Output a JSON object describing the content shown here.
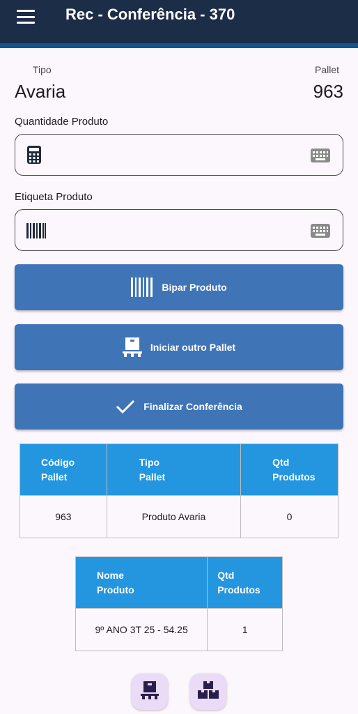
{
  "appbar": {
    "title": "Rec - Conferência - 370",
    "menu_icon": "menu-icon"
  },
  "header": {
    "tipo_label": "Tipo",
    "tipo_value": "Avaria",
    "pallet_label": "Pallet",
    "pallet_value": "963"
  },
  "form": {
    "quantidade": {
      "label": "Quantidade Produto",
      "value": "",
      "icon": "calculator-icon"
    },
    "etiqueta": {
      "label": "Etiqueta Produto",
      "value": "",
      "icon": "barcode-icon"
    }
  },
  "buttons": {
    "bipar": "Bipar Produto",
    "iniciar": "Iniciar outro Pallet",
    "finalizar": "Finalizar Conferência"
  },
  "pallet_table": {
    "headers": [
      [
        "Código",
        "Pallet"
      ],
      [
        "Tipo",
        "Pallet"
      ],
      [
        "Qtd",
        "Produtos"
      ]
    ],
    "rows": [
      [
        "963",
        "Produto Avaria",
        "0"
      ]
    ]
  },
  "product_table": {
    "headers": [
      [
        "Nome",
        "Produto"
      ],
      [
        "Qtd",
        "Produtos"
      ]
    ],
    "rows": [
      [
        "9º ANO 3T 25 - 54.25",
        "1"
      ]
    ]
  },
  "fabs": [
    "pallet-icon",
    "boxes-icon"
  ],
  "colors": {
    "appbar": "#1c2d47",
    "stripe": "#15538f",
    "button": "#3f74b7",
    "table_header": "#2496e0",
    "fab": "#eadcf7",
    "background": "#fcf7fd"
  }
}
